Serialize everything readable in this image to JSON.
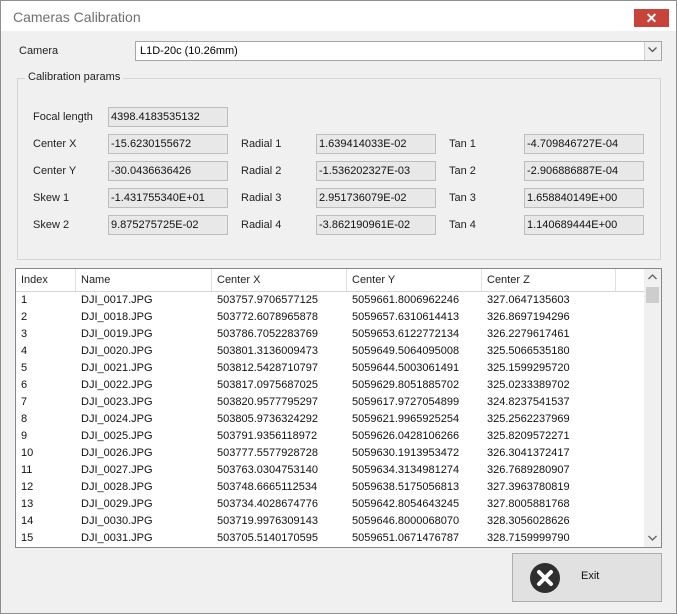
{
  "window": {
    "title": "Cameras Calibration",
    "close_glyph": "✕"
  },
  "camera": {
    "label": "Camera",
    "selected": "L1D-20c (10.26mm)"
  },
  "calibration": {
    "title": "Calibration params",
    "focal_length": {
      "label": "Focal length",
      "value": "4398.4183535132"
    },
    "center_x": {
      "label": "Center X",
      "value": "-15.6230155672"
    },
    "center_y": {
      "label": "Center Y",
      "value": "-30.0436636426"
    },
    "skew1": {
      "label": "Skew 1",
      "value": "-1.431755340E+01"
    },
    "skew2": {
      "label": "Skew 2",
      "value": "9.875275725E-02"
    },
    "radial1": {
      "label": "Radial 1",
      "value": "1.639414033E-02"
    },
    "radial2": {
      "label": "Radial 2",
      "value": "-1.536202327E-03"
    },
    "radial3": {
      "label": "Radial 3",
      "value": "2.951736079E-02"
    },
    "radial4": {
      "label": "Radial 4",
      "value": "-3.862190961E-02"
    },
    "tan1": {
      "label": "Tan 1",
      "value": "-4.709846727E-04"
    },
    "tan2": {
      "label": "Tan 2",
      "value": "-2.906886887E-04"
    },
    "tan3": {
      "label": "Tan 3",
      "value": "1.658840149E+00"
    },
    "tan4": {
      "label": "Tan 4",
      "value": "1.140689444E+00"
    }
  },
  "table": {
    "columns": [
      "Index",
      "Name",
      "Center X",
      "Center Y",
      "Center Z"
    ],
    "rows": [
      [
        "1",
        "DJI_0017.JPG",
        "503757.9706577125",
        "5059661.8006962246",
        "327.0647135603"
      ],
      [
        "2",
        "DJI_0018.JPG",
        "503772.6078965878",
        "5059657.6310614413",
        "326.8697194296"
      ],
      [
        "3",
        "DJI_0019.JPG",
        "503786.7052283769",
        "5059653.6122772134",
        "326.2279617461"
      ],
      [
        "4",
        "DJI_0020.JPG",
        "503801.3136009473",
        "5059649.5064095008",
        "325.5066535180"
      ],
      [
        "5",
        "DJI_0021.JPG",
        "503812.5428710797",
        "5059644.5003061491",
        "325.1599295720"
      ],
      [
        "6",
        "DJI_0022.JPG",
        "503817.0975687025",
        "5059629.8051885702",
        "325.0233389702"
      ],
      [
        "7",
        "DJI_0023.JPG",
        "503820.9577795297",
        "5059617.9727054899",
        "324.8237541537"
      ],
      [
        "8",
        "DJI_0024.JPG",
        "503805.9736324292",
        "5059621.9965925254",
        "325.2562237969"
      ],
      [
        "9",
        "DJI_0025.JPG",
        "503791.9356118972",
        "5059626.0428106266",
        "325.8209572271"
      ],
      [
        "10",
        "DJI_0026.JPG",
        "503777.5577928728",
        "5059630.1913953472",
        "326.3041372417"
      ],
      [
        "11",
        "DJI_0027.JPG",
        "503763.0304753140",
        "5059634.3134981274",
        "326.7689280907"
      ],
      [
        "12",
        "DJI_0028.JPG",
        "503748.6665112534",
        "5059638.5175056813",
        "327.3963780819"
      ],
      [
        "13",
        "DJI_0029.JPG",
        "503734.4028674776",
        "5059642.8054643245",
        "327.8005881768"
      ],
      [
        "14",
        "DJI_0030.JPG",
        "503719.9976309143",
        "5059646.8000068070",
        "328.3056028626"
      ],
      [
        "15",
        "DJI_0031.JPG",
        "503705.5140170595",
        "5059651.0671476787",
        "328.7159999790"
      ]
    ]
  },
  "footer": {
    "exit_label": "Exit",
    "exit_icon": "close-circle-icon"
  },
  "colors": {
    "close_button": "#c8433a",
    "field_bg": "#e8e8e8",
    "window_bg": "#f0f0f0"
  }
}
